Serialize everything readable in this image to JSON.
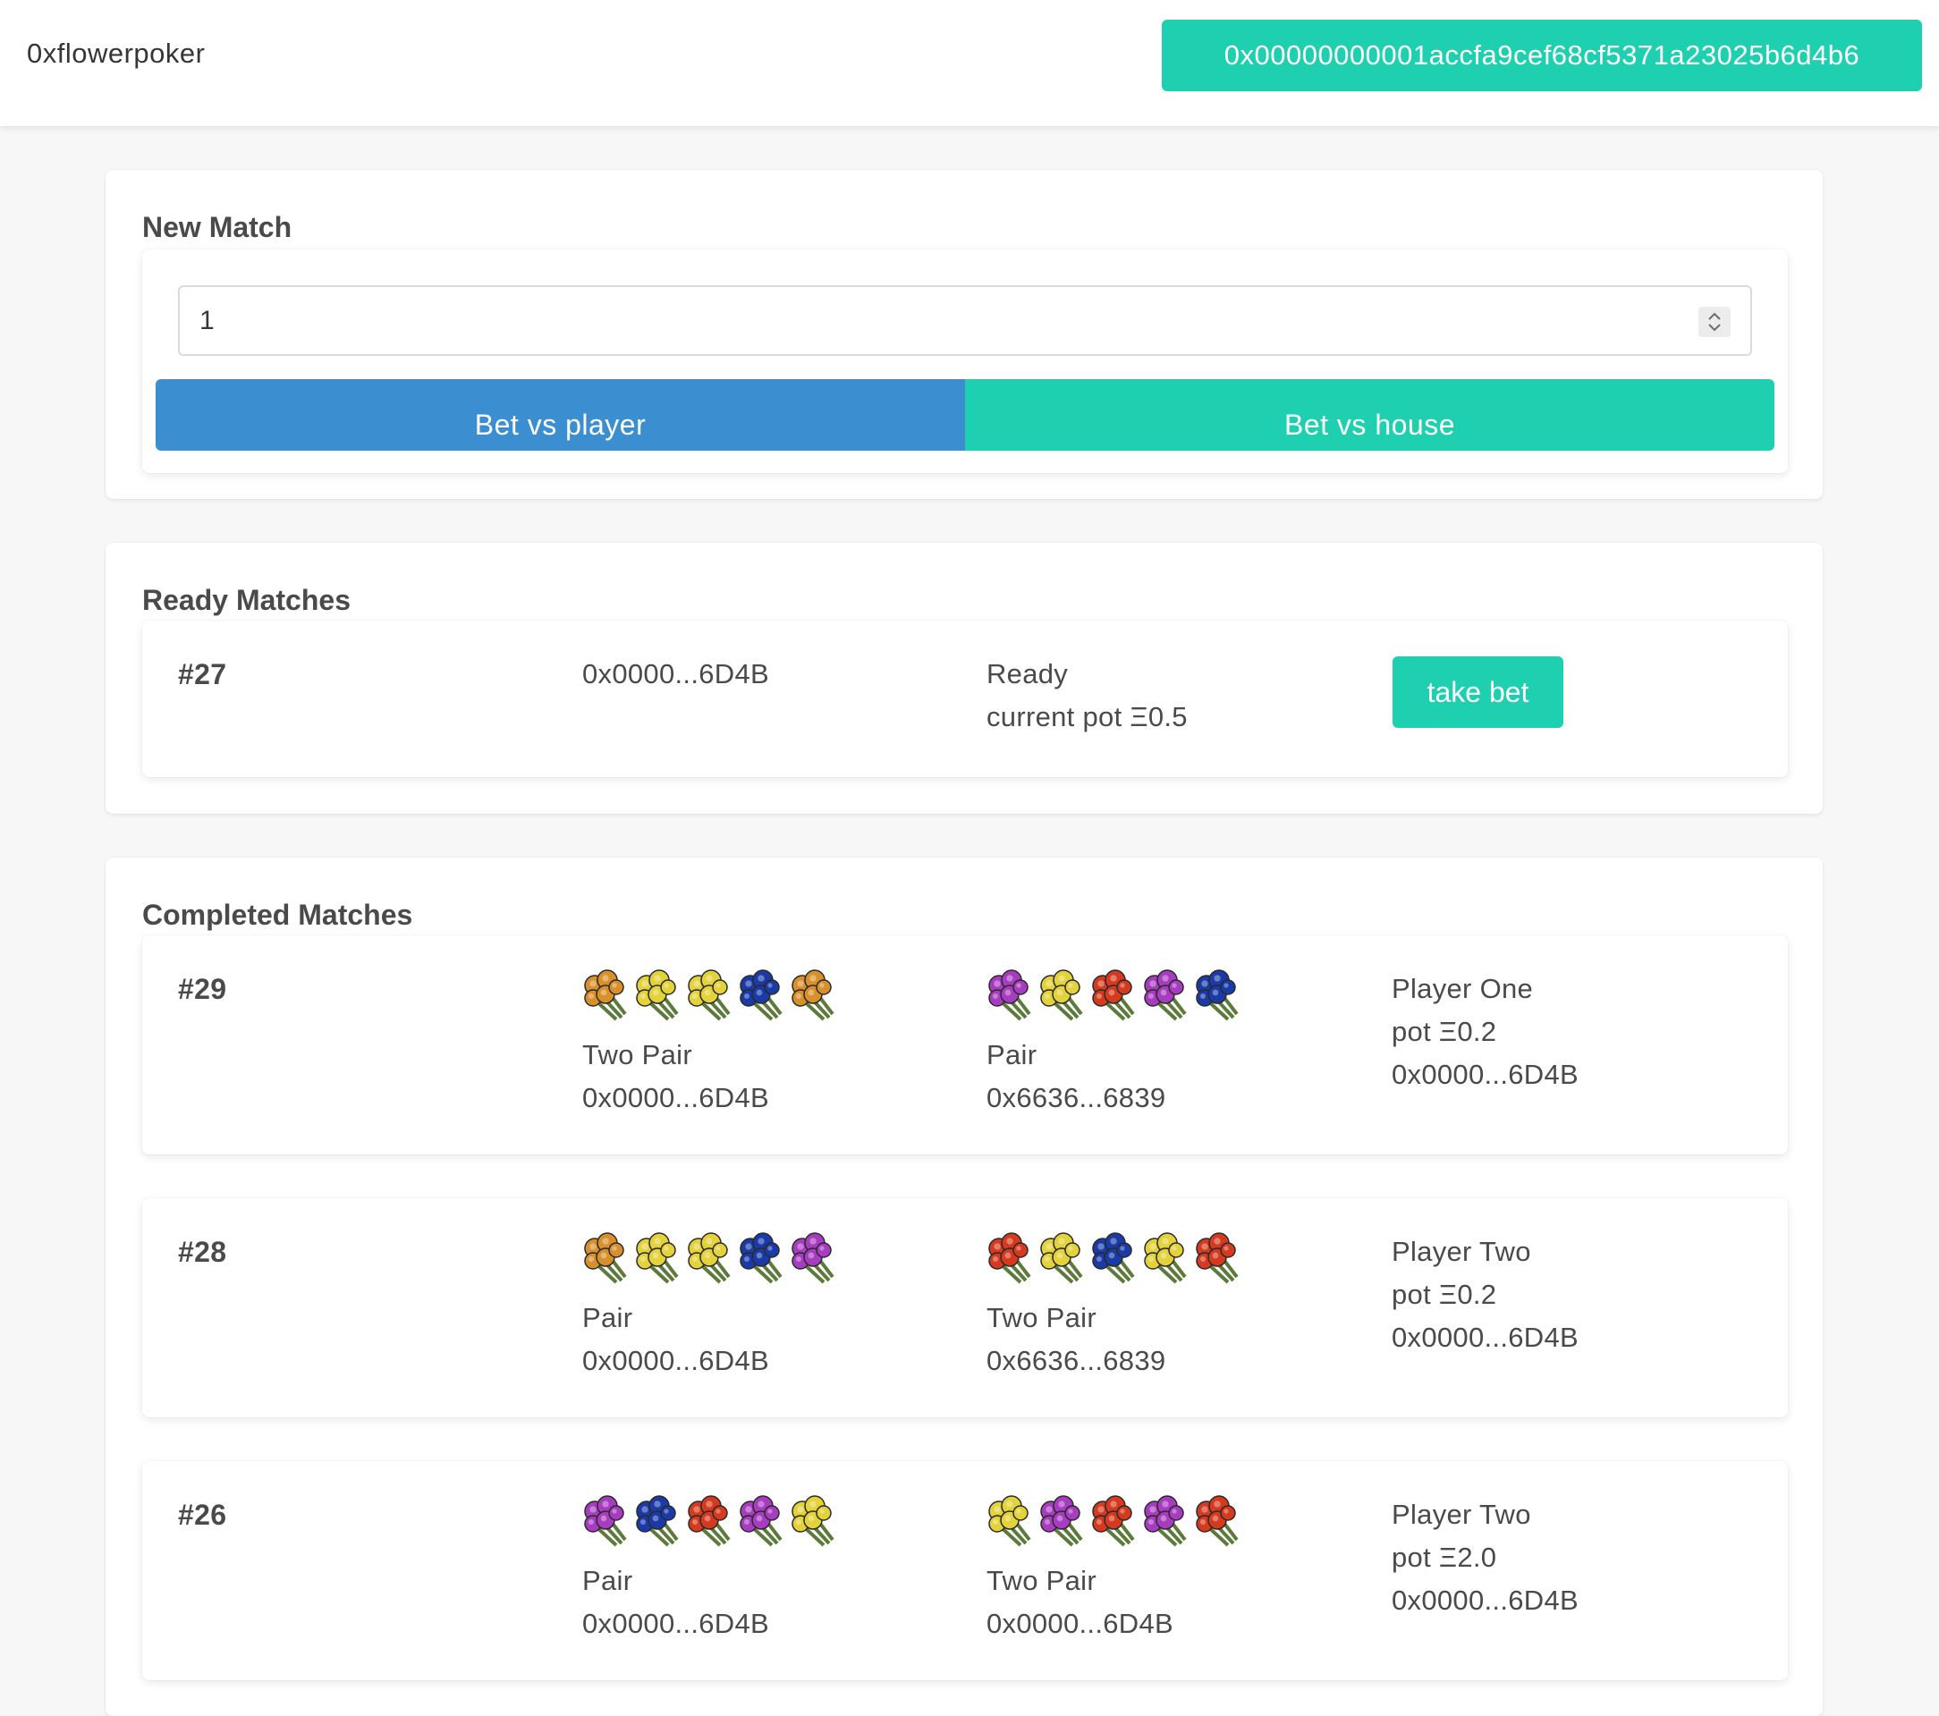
{
  "header": {
    "brand": "0xflowerpoker",
    "account": "0x00000000001accfa9cef68cf5371a23025b6d4b6"
  },
  "new_match": {
    "title": "New Match",
    "amount_value": "1",
    "bet_player_label": "Bet vs player",
    "bet_house_label": "Bet vs house"
  },
  "ready": {
    "title": "Ready Matches",
    "matches": [
      {
        "id": "#27",
        "address": "0x0000...6D4B",
        "status": "Ready",
        "pot": "current pot Ξ0.5",
        "action_label": "take bet"
      }
    ]
  },
  "completed": {
    "title": "Completed Matches",
    "matches": [
      {
        "id": "#29",
        "p1": {
          "flowers": [
            "orange",
            "yellow",
            "yellow",
            "blue",
            "orange"
          ],
          "hand": "Two Pair",
          "address": "0x0000...6D4B"
        },
        "p2": {
          "flowers": [
            "purple",
            "yellow",
            "red",
            "purple",
            "blue"
          ],
          "hand": "Pair",
          "address": "0x6636...6839"
        },
        "winner": "Player One",
        "pot": "pot Ξ0.2",
        "winner_address": "0x0000...6D4B"
      },
      {
        "id": "#28",
        "p1": {
          "flowers": [
            "orange",
            "yellow",
            "yellow",
            "blue",
            "purple"
          ],
          "hand": "Pair",
          "address": "0x0000...6D4B"
        },
        "p2": {
          "flowers": [
            "red",
            "yellow",
            "blue",
            "yellow",
            "red"
          ],
          "hand": "Two Pair",
          "address": "0x6636...6839"
        },
        "winner": "Player Two",
        "pot": "pot Ξ0.2",
        "winner_address": "0x0000...6D4B"
      },
      {
        "id": "#26",
        "p1": {
          "flowers": [
            "purple",
            "blue",
            "red",
            "purple",
            "yellow"
          ],
          "hand": "Pair",
          "address": "0x0000...6D4B"
        },
        "p2": {
          "flowers": [
            "yellow",
            "purple",
            "red",
            "purple",
            "red"
          ],
          "hand": "Two Pair",
          "address": "0x0000...6D4B"
        },
        "winner": "Player Two",
        "pot": "pot Ξ2.0",
        "winner_address": "0x0000...6D4B"
      }
    ]
  },
  "colors": {
    "accent_teal": "#1ed0b0",
    "accent_blue": "#3b8fd0",
    "flower_orange": "#d9902a",
    "flower_yellow": "#e3d23a",
    "flower_blue": "#1a3aa8",
    "flower_purple": "#a83cc0",
    "flower_red": "#d63a1e"
  }
}
